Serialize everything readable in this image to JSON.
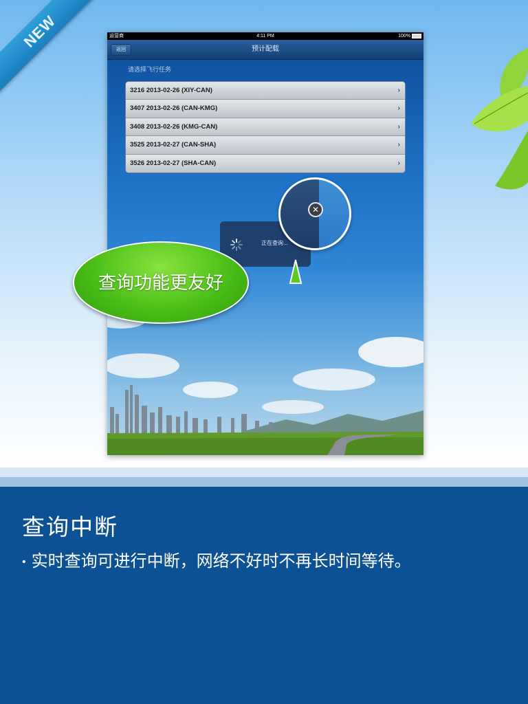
{
  "ribbon": {
    "label": "NEW"
  },
  "screen": {
    "status": {
      "carrier": "运营商",
      "time": "4:11 PM",
      "battery": "100%"
    },
    "nav": {
      "back_label": "返回",
      "title": "预计配载"
    },
    "prompt": "请选择飞行任务",
    "flights": [
      {
        "label": "3216  2013-02-26 (XIY-CAN)"
      },
      {
        "label": "3407  2013-02-26 (CAN-KMG)"
      },
      {
        "label": "3408  2013-02-26 (KMG-CAN)"
      },
      {
        "label": "3525  2013-02-27 (CAN-SHA)"
      },
      {
        "label": "3526  2013-02-27 (SHA-CAN)"
      }
    ],
    "loading": {
      "text": "正在查询..."
    },
    "close_icon": "close-icon"
  },
  "callout": {
    "text": "查询功能更友好"
  },
  "feature": {
    "title": "查询中断",
    "bullet": "实时查询可进行中断，网络不好时不再长时间等待。"
  },
  "colors": {
    "accent": "#0b5194",
    "callout": "#4bbf18"
  }
}
